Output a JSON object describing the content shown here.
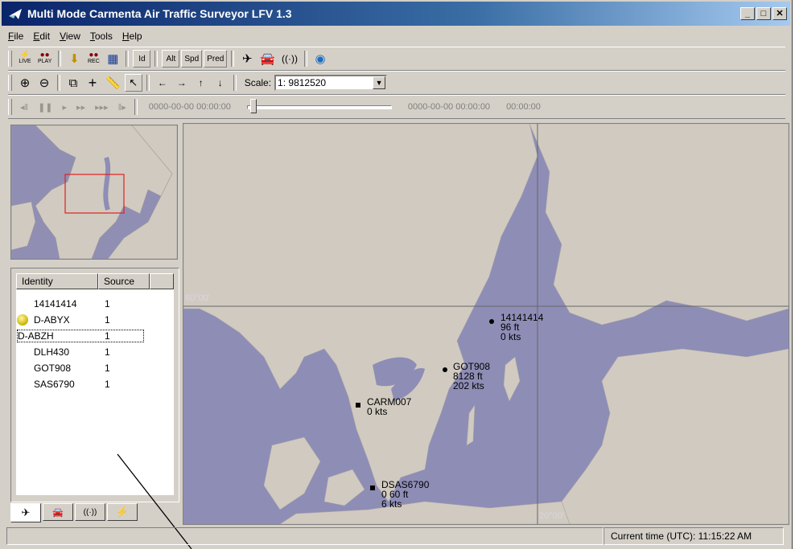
{
  "window": {
    "title": "Multi Mode Carmenta Air Traffic Surveyor LFV 1.3",
    "min": "_",
    "max": "□",
    "close": "✕"
  },
  "menu": [
    "File",
    "Edit",
    "View",
    "Tools",
    "Help"
  ],
  "toolbar1": {
    "live": "LIVE",
    "play": "PLAY",
    "rec": "REC",
    "id": "Id",
    "alt": "Alt",
    "spd": "Spd",
    "pred": "Pred"
  },
  "toolbar2": {
    "scale_label": "Scale:",
    "scale_value": "1: 9812520"
  },
  "playback": {
    "start_time": "0000-00-00 00:00:00",
    "end_time": "0000-00-00 00:00:00",
    "duration": "00:00:00"
  },
  "list": {
    "headers": [
      "Identity",
      "Source"
    ],
    "rows": [
      {
        "identity": "14141414",
        "source": "1"
      },
      {
        "identity": "D-ABYX",
        "source": "1"
      },
      {
        "identity": "D-ABZH",
        "source": "1"
      },
      {
        "identity": "DLH430",
        "source": "1"
      },
      {
        "identity": "GOT908",
        "source": "1"
      },
      {
        "identity": "SAS6790",
        "source": "1"
      }
    ]
  },
  "map": {
    "grid_lat": "60°00'",
    "grid_lon": "20°00'",
    "targets": [
      {
        "label": "14141414",
        "alt": "96 ft",
        "spd": "0 kts"
      },
      {
        "label": "GOT908",
        "alt": "8128 ft",
        "spd": "202 kts"
      },
      {
        "label": "CARM007",
        "spd": "0 kts"
      },
      {
        "label": "DSAS6790",
        "alt": "0 60 ft",
        "spd": "6 kts"
      }
    ]
  },
  "status": {
    "left": "",
    "time": "Current time (UTC): 11:15:22 AM"
  },
  "colors": {
    "water": "#8e8db6",
    "land": "#d1cac0",
    "title_start": "#0a246a",
    "chrome": "#d4d0c8"
  }
}
